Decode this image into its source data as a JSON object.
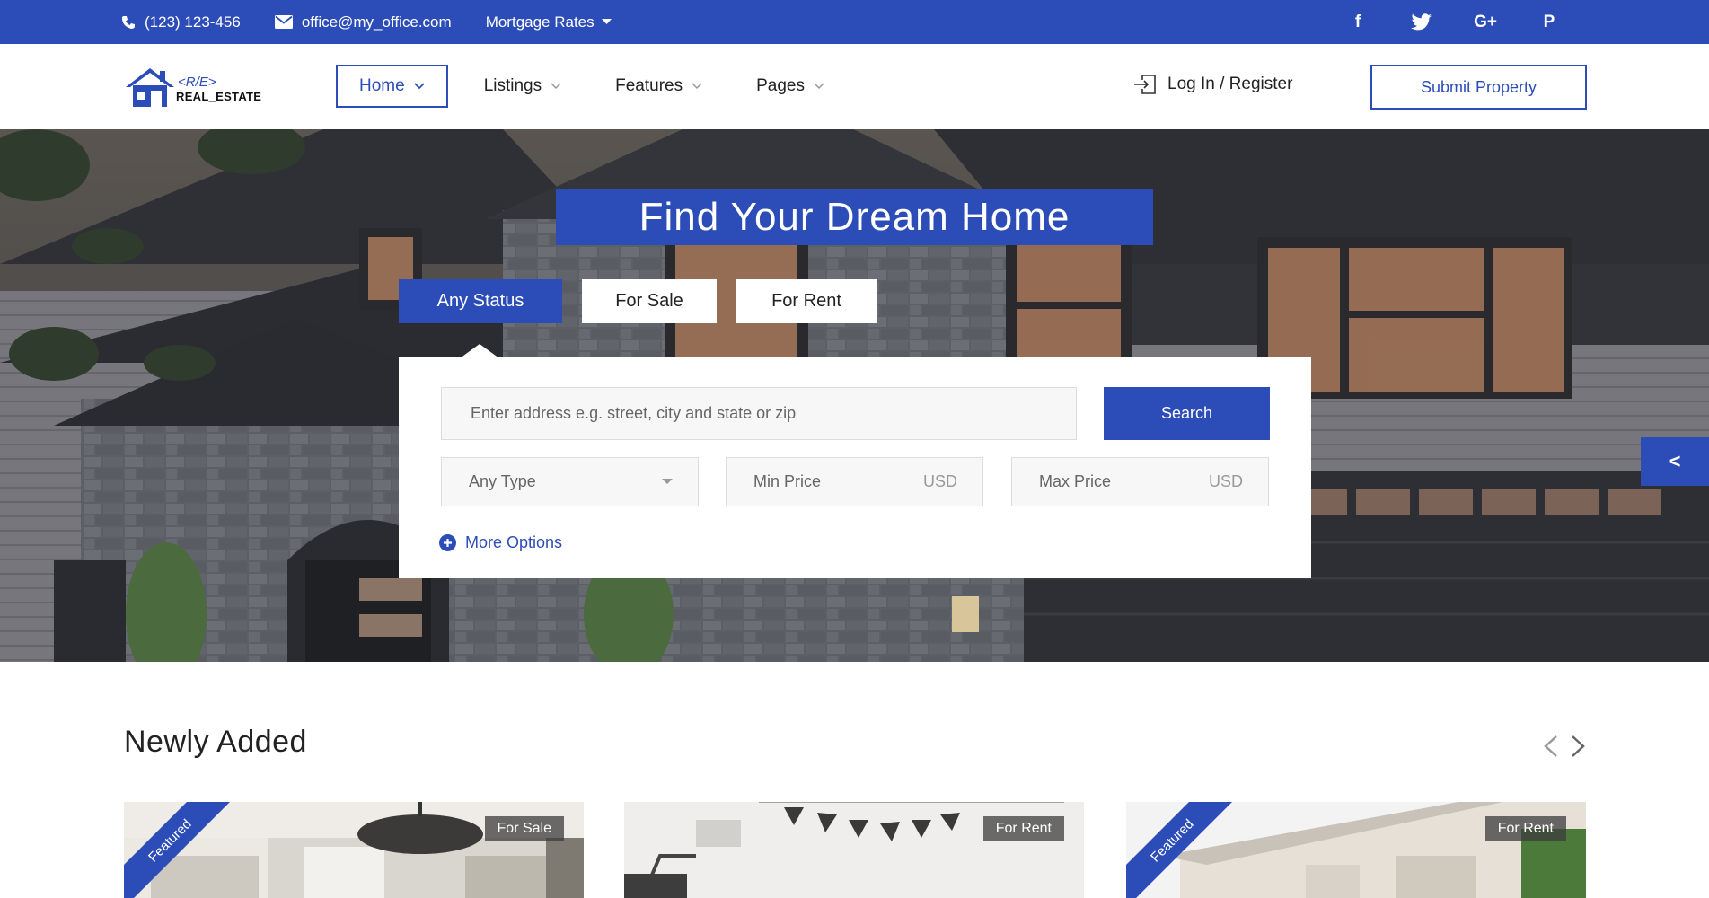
{
  "topbar": {
    "phone": "(123) 123-456",
    "email": "office@my_office.com",
    "mortgage": "Mortgage Rates",
    "social": [
      "facebook-icon",
      "twitter-icon",
      "google-plus-icon",
      "pinterest-icon"
    ],
    "social_glyphs": {
      "facebook": "f",
      "google": "G+",
      "pinterest": "P"
    }
  },
  "brand": {
    "logo_code": "<R/E>",
    "logo_text": "REAL_ESTATE"
  },
  "nav": {
    "items": [
      {
        "label": "Home"
      },
      {
        "label": "Listings"
      },
      {
        "label": "Features"
      },
      {
        "label": "Pages"
      }
    ],
    "login": "Log In / Register",
    "submit": "Submit Property"
  },
  "hero": {
    "title": "Find Your Dream Home",
    "tabs": [
      "Any Status",
      "For Sale",
      "For Rent"
    ],
    "address_placeholder": "Enter address e.g. street, city and state or zip",
    "search_label": "Search",
    "type_label": "Any Type",
    "min_label": "Min Price",
    "max_label": "Max Price",
    "currency": "USD",
    "more_options": "More Options",
    "side_tab": "<"
  },
  "listings": {
    "title": "Newly Added",
    "cards": [
      {
        "status": "For Sale",
        "ribbon": "Featured"
      },
      {
        "status": "For Rent",
        "ribbon": ""
      },
      {
        "status": "For Rent",
        "ribbon": "Featured"
      }
    ]
  },
  "colors": {
    "accent": "#2c4db7"
  }
}
